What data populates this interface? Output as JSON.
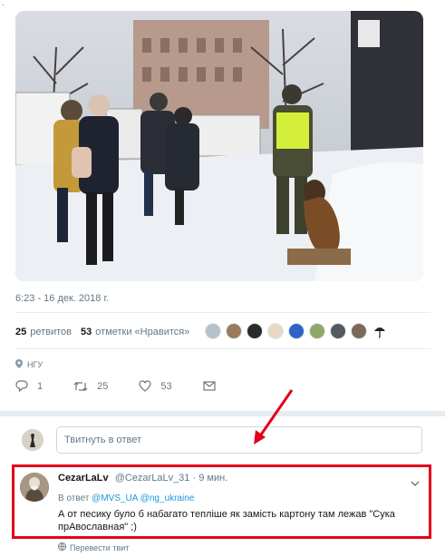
{
  "tweet": {
    "photo": {
      "description_icon": "photo-icon"
    },
    "timestamp": "6:23 - 16 дек. 2018 г.",
    "stats": {
      "retweets_count": "25",
      "retweets_label": "ретвитов",
      "likes_count": "53",
      "likes_label": "отметки «Нравится»"
    },
    "location": "НГУ",
    "actions": {
      "reply_count": "1",
      "retweet_count": "25",
      "like_count": "53"
    }
  },
  "reply_composer": {
    "placeholder": "Твитнуть в ответ"
  },
  "reply_tweet": {
    "name": "CezarLaLv",
    "handle": "@CezarLaLv_31",
    "time": "· 9 мин.",
    "reply_to_label": "В ответ",
    "mention_1": "@MVS_UA",
    "mention_2": "@ng_ukraine",
    "text": "А от песику було б набагато тепліше як замість картону там лежав \"Сука прАвославная\" ;)",
    "translate_label": "Перевести твит"
  },
  "colors": {
    "accent": "#1b95e0",
    "highlight_border": "#e3001b",
    "muted_text": "#657786"
  }
}
